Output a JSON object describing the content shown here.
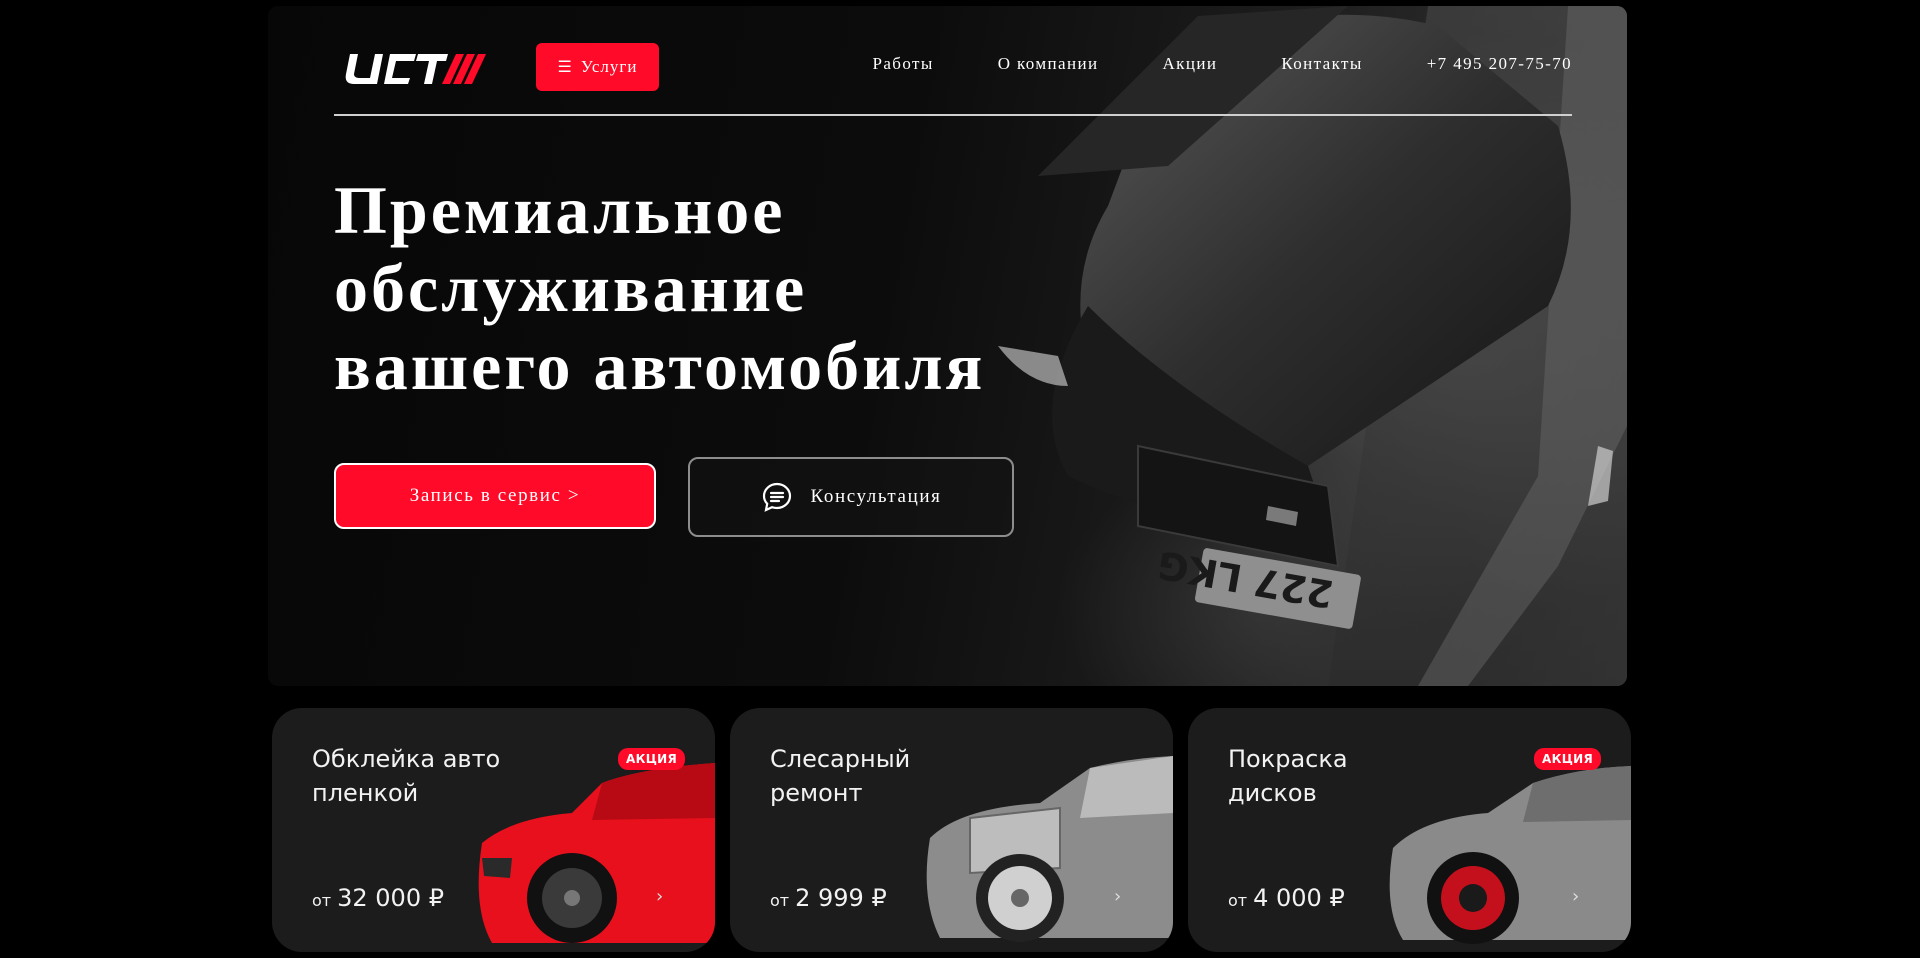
{
  "header": {
    "logo_alt": "UCT",
    "services_label": "Услуги",
    "nav": [
      {
        "label": "Работы"
      },
      {
        "label": "О компании"
      },
      {
        "label": "Акции"
      },
      {
        "label": "Контакты"
      },
      {
        "label": "+7 495 207-75-70"
      }
    ]
  },
  "hero": {
    "title_lines": [
      "Премиальное",
      "обслуживание",
      "вашего автомобиля"
    ],
    "primary_button": "Запись в сервис >",
    "secondary_button": "Консультация",
    "plate_text": "227 LKG"
  },
  "cards": [
    {
      "title": "Обклейка авто пленкой",
      "badge": "АКЦИЯ",
      "price_prefix": "от",
      "price": "32 000 ₽",
      "accent": "#e8101c"
    },
    {
      "title": "Слесарный ремонт",
      "badge": "",
      "price_prefix": "от",
      "price": "2 999 ₽",
      "accent": "#9a9a9a"
    },
    {
      "title": "Покраска дисков",
      "badge": "АКЦИЯ",
      "price_prefix": "от",
      "price": "4 000 ₽",
      "accent": "#7a7a7a"
    }
  ],
  "colors": {
    "accent": "#ff0a28",
    "background": "#000000",
    "card_bg": "#1c1c1c"
  }
}
